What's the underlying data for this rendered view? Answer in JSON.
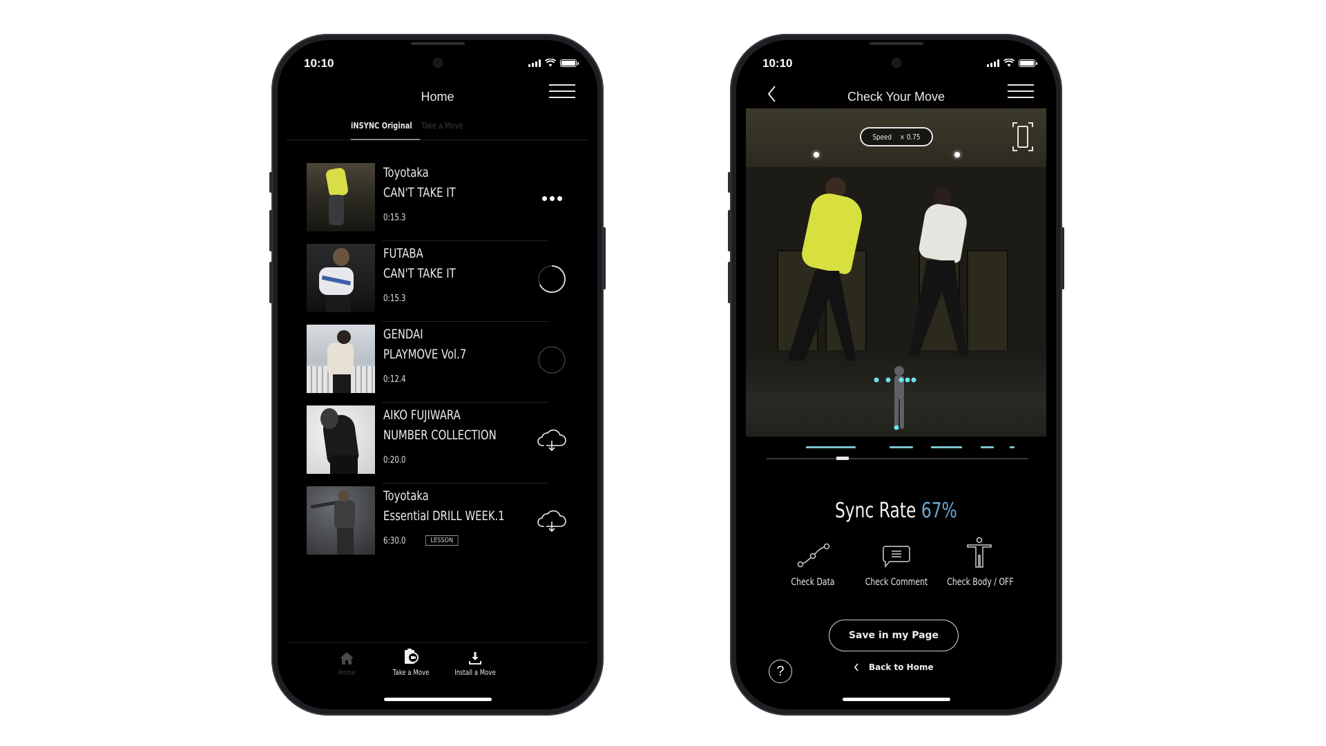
{
  "left_phone": {
    "status": {
      "time": "10:10"
    },
    "header": {
      "title": "Home",
      "menu_icon": "hamburger-menu-icon"
    },
    "tabs": [
      {
        "label": "iNSYNC Original",
        "active": true
      },
      {
        "label": "Take a Move",
        "active": false
      }
    ],
    "items": [
      {
        "artist": "Toyotaka",
        "title": "CAN'T TAKE IT",
        "duration": "0:15.3",
        "action": "more-options",
        "action_icon": "more-horizontal-icon",
        "thumb_palette": [
          "#2c2a22",
          "#d8dd48"
        ]
      },
      {
        "artist": "FUTABA",
        "title": "CAN'T TAKE IT",
        "duration": "0:15.3",
        "action": "downloading",
        "action_icon": "progress-ring-icon",
        "download_progress": 0.68,
        "thumb_palette": [
          "#1c1d1f",
          "#e8e8ec"
        ]
      },
      {
        "artist": "GENDAI",
        "title": "PLAYMOVE Vol.7",
        "duration": "0:12.4",
        "action": "queued",
        "action_icon": "empty-ring-icon",
        "download_progress": 0,
        "thumb_palette": [
          "#c6ccd1",
          "#e7e0d4"
        ]
      },
      {
        "artist": "AIKO FUJIWARA",
        "title": "NUMBER COLLECTION",
        "duration": "0:20.0",
        "action": "download",
        "action_icon": "cloud-download-icon",
        "thumb_palette": [
          "#e8e8e8",
          "#1a1a1a"
        ]
      },
      {
        "artist": "Toyotaka",
        "title": "Essential DRILL WEEK.1",
        "duration": "6:30.0",
        "badge": "LESSON",
        "action": "download",
        "action_icon": "cloud-download-icon",
        "thumb_palette": [
          "#5a5c60",
          "#3a3a3a"
        ]
      }
    ],
    "bottom_nav": [
      {
        "label": "Home",
        "icon": "home-icon",
        "active": false
      },
      {
        "label": "Take a Move",
        "icon": "camera-clip-icon",
        "active": true
      },
      {
        "label": "Install a Move",
        "icon": "download-tray-icon",
        "active": true
      }
    ]
  },
  "right_phone": {
    "status": {
      "time": "10:10"
    },
    "header": {
      "title": "Check Your Move",
      "back_icon": "chevron-left-icon",
      "menu_icon": "hamburger-menu-icon"
    },
    "video": {
      "speed_label": "Speed",
      "speed_multiplier": "× 0.75",
      "rotate_icon": "rotate-screen-icon"
    },
    "timeline": {
      "sync_segments": [
        [
          0.15,
          0.34
        ],
        [
          0.47,
          0.56
        ],
        [
          0.63,
          0.75
        ],
        [
          0.82,
          0.87
        ],
        [
          0.93,
          0.95
        ]
      ],
      "playhead_position": 0.29,
      "segment_color": "#7cc6cf"
    },
    "sync_rate": {
      "label": "Sync Rate",
      "value": "67%",
      "value_color": "#6aa8d6"
    },
    "actions": [
      {
        "label": "Check Data",
        "icon": "line-graph-icon"
      },
      {
        "label": "Check Comment",
        "icon": "comment-bubble-icon"
      },
      {
        "label": "Check Body / OFF",
        "icon": "body-figure-icon"
      }
    ],
    "save_button": "Save in my Page",
    "back_home": "Back to Home",
    "help_icon": "question-circle-icon",
    "help_glyph": "?"
  }
}
